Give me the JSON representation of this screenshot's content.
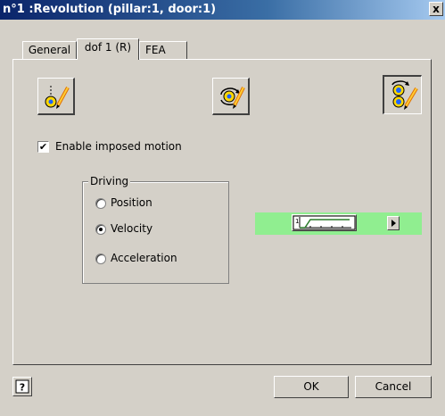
{
  "window": {
    "title": "n°1 :Revolution (pillar:1, door:1)",
    "close_label": "x"
  },
  "tabs": [
    {
      "label": "General"
    },
    {
      "label": "dof 1 (R)",
      "active": true
    },
    {
      "label": "FEA"
    }
  ],
  "toolbar": {
    "buttons": [
      {
        "icon": "axis-edit-icon"
      },
      {
        "icon": "rotation-edit-icon"
      },
      {
        "icon": "driving-edit-icon",
        "pressed": true
      }
    ]
  },
  "imposed_motion": {
    "label": "Enable imposed motion",
    "checked": true
  },
  "driving": {
    "legend": "Driving",
    "options": [
      {
        "label": "Position",
        "selected": false
      },
      {
        "label": "Velocity",
        "selected": true
      },
      {
        "label": "Acceleration",
        "selected": false
      }
    ]
  },
  "motion_curve": {
    "icon": "motion-curve-graph-icon",
    "arrow_icon": "right-arrow-icon",
    "highlight_color": "#90ee90"
  },
  "footer": {
    "help_label": "?",
    "ok_label": "OK",
    "cancel_label": "Cancel"
  }
}
